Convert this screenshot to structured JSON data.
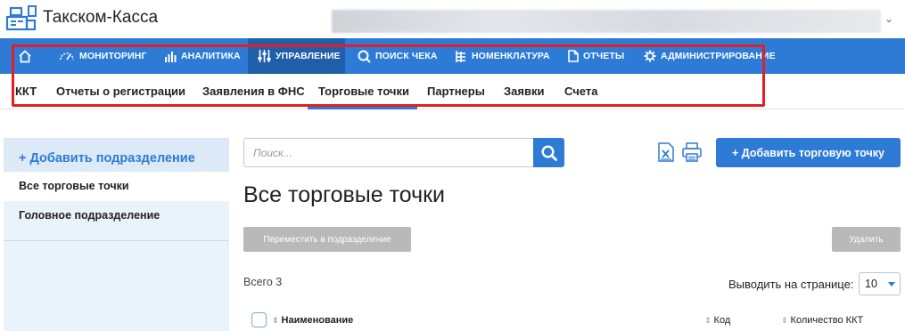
{
  "header": {
    "app_title": "Такском-Касса"
  },
  "main_nav": {
    "items": [
      {
        "label": "",
        "icon": "home-icon"
      },
      {
        "label": "МОНИТОРИНГ",
        "icon": "gauge-icon"
      },
      {
        "label": "АНАЛИТИКА",
        "icon": "bar-chart-icon"
      },
      {
        "label": "УПРАВЛЕНИЕ",
        "icon": "sliders-icon",
        "active": true
      },
      {
        "label": "ПОИСК ЧЕКА",
        "icon": "search-icon"
      },
      {
        "label": "НОМЕНКЛАТУРА",
        "icon": "hierarchy-icon"
      },
      {
        "label": "ОТЧЕТЫ",
        "icon": "document-icon"
      },
      {
        "label": "АДМИНИСТРИРОВАНИЕ",
        "icon": "gear-icon"
      }
    ],
    "active_color": "#1f5ea8",
    "bg_color": "#2e7bd6"
  },
  "sub_nav": {
    "items": [
      {
        "label": "ККТ"
      },
      {
        "label": "Отчеты о регистрации"
      },
      {
        "label": "Заявления в ФНС"
      },
      {
        "label": "Торговые точки",
        "active": true
      },
      {
        "label": "Партнеры"
      },
      {
        "label": "Заявки"
      },
      {
        "label": "Счета"
      }
    ]
  },
  "sidebar": {
    "add_label": "+ Добавить подразделение",
    "items": [
      {
        "label": "Все торговые точки",
        "selected": true
      },
      {
        "label": "Головное подразделение"
      }
    ]
  },
  "toolbar": {
    "search_placeholder": "Поиск...",
    "add_button": "+ Добавить торговую точку",
    "export_icon": "excel-export-icon",
    "print_icon": "printer-icon"
  },
  "main": {
    "page_title": "Все торговые точки",
    "move_button": "Переместить в подразделение",
    "delete_button": "Удалить",
    "total": "Всего 3",
    "per_page_label": "Выводить на странице:",
    "per_page_value": "10"
  },
  "table": {
    "columns": [
      "Наименование",
      "Код",
      "Количество ККТ"
    ]
  },
  "colors": {
    "accent": "#2e7bd6",
    "highlight": "#e31e24"
  }
}
